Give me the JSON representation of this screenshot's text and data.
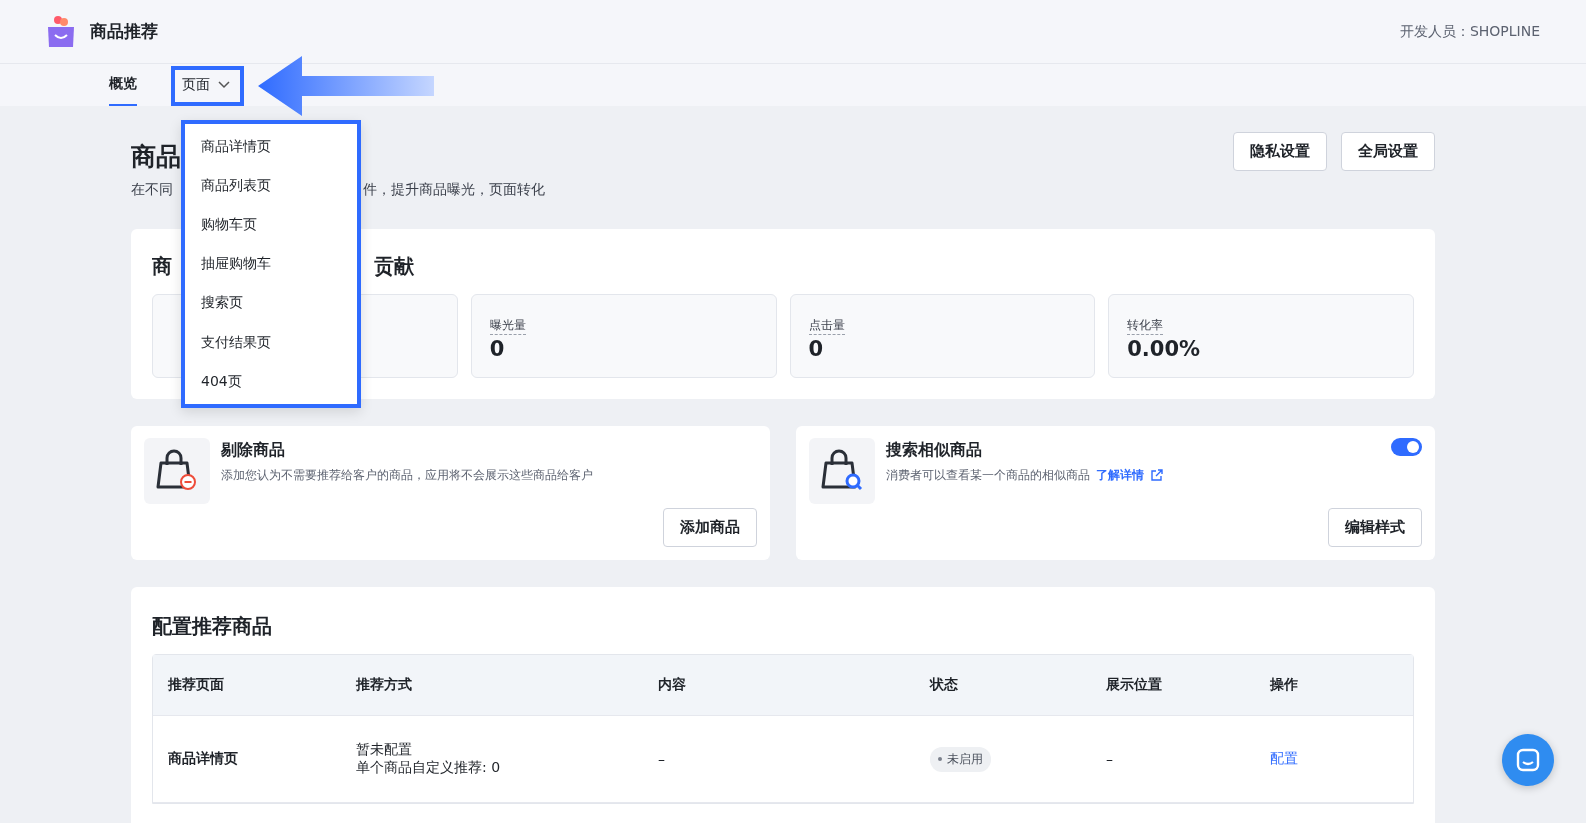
{
  "app": {
    "name": "商品推荐",
    "developer": "开发人员：SHOPLINE"
  },
  "tabs": [
    {
      "label": "概览",
      "selected": true,
      "kind": "tab",
      "highlighted": false
    },
    {
      "label": "页面",
      "selected": false,
      "kind": "dropdown",
      "highlighted": true,
      "expanded": true
    }
  ],
  "dropdown_menu": [
    "商品详情页",
    "商品列表页",
    "购物车页",
    "抽屉购物车",
    "搜索页",
    "支付结果页",
    "404页"
  ],
  "header": {
    "title": "商品",
    "description_parts": [
      "在不同",
      "件，提升商品曝光，页面转化"
    ],
    "buttons": [
      "隐私设置",
      "全局设置"
    ]
  },
  "stats": {
    "title_parts": [
      "商",
      "贡献"
    ],
    "cards": [
      {
        "label": "曝光量",
        "value": "0"
      },
      {
        "label": "点击量",
        "value": "0"
      },
      {
        "label": "转化率",
        "value": "0.00%"
      }
    ]
  },
  "features": [
    {
      "kind": "exclude",
      "title": "剔除商品",
      "description": "添加您认为不需要推荐给客户的商品，应用将不会展示这些商品给客户",
      "button": "添加商品"
    },
    {
      "kind": "search",
      "title": "搜索相似商品",
      "description": "消费者可以查看某一个商品的相似商品",
      "link": "了解详情",
      "toggle_on": true,
      "button": "编辑样式"
    }
  ],
  "config": {
    "title": "配置推荐商品",
    "columns": [
      "推荐页面",
      "推荐方式",
      "内容",
      "状态",
      "展示位置",
      "操作"
    ],
    "rows": [
      {
        "page": "商品详情页",
        "method_lines": [
          "暂未配置",
          "单个商品自定义推荐: 0"
        ],
        "content": "–",
        "status": {
          "label": "未启用",
          "enabled": false
        },
        "position": "–",
        "action": "配置"
      }
    ]
  }
}
